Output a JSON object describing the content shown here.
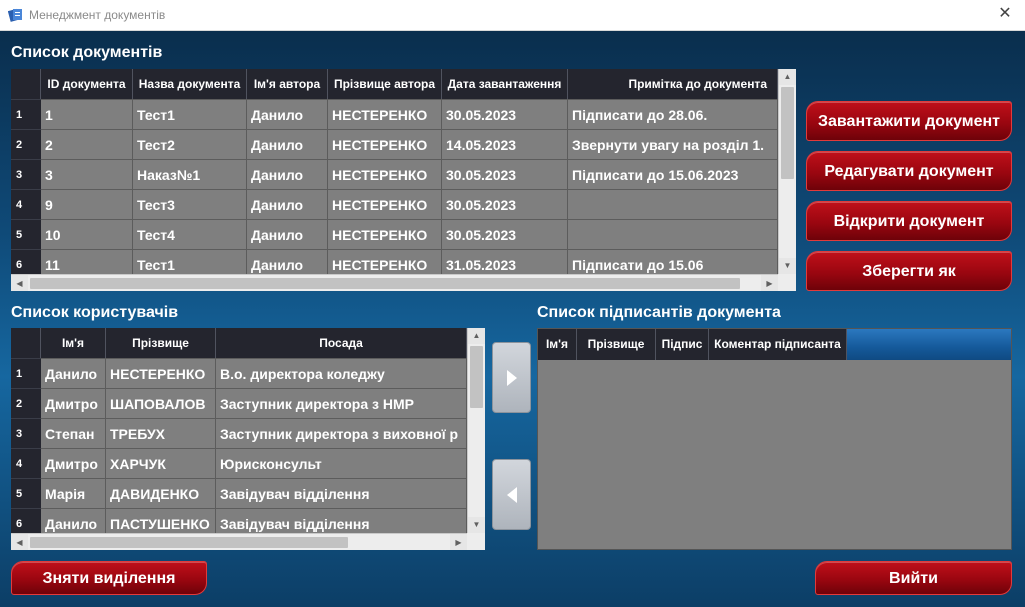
{
  "window": {
    "title": "Менеджмент документів",
    "close_glyph": "✕"
  },
  "documents": {
    "title": "Список документів",
    "columns": [
      "ID документа",
      "Назва документа",
      "Ім'я автора",
      "Прізвище автора",
      "Дата завантаження",
      "Примітка до документа"
    ],
    "rows": [
      {
        "num": "1",
        "cells": [
          "1",
          "Тест1",
          "Данило",
          "НЕСТЕРЕНКО",
          "30.05.2023",
          "Підписати до 28.06."
        ]
      },
      {
        "num": "2",
        "cells": [
          "2",
          "Тест2",
          "Данило",
          "НЕСТЕРЕНКО",
          "14.05.2023",
          "Звернути увагу на розділ 1."
        ]
      },
      {
        "num": "3",
        "cells": [
          "3",
          "Наказ№1",
          "Данило",
          "НЕСТЕРЕНКО",
          "30.05.2023",
          "Підписати до 15.06.2023"
        ]
      },
      {
        "num": "4",
        "cells": [
          "9",
          "Тест3",
          "Данило",
          "НЕСТЕРЕНКО",
          "30.05.2023",
          ""
        ]
      },
      {
        "num": "5",
        "cells": [
          "10",
          "Тест4",
          "Данило",
          "НЕСТЕРЕНКО",
          "30.05.2023",
          ""
        ]
      },
      {
        "num": "6",
        "cells": [
          "11",
          "Тест1",
          "Данило",
          "НЕСТЕРЕНКО",
          "31.05.2023",
          "Підписати до 15.06"
        ]
      }
    ]
  },
  "actions": {
    "upload": "Завантажити документ",
    "edit": "Редагувати документ",
    "open": "Відкрити документ",
    "save_as": "Зберегти як",
    "clear_selection": "Зняти виділення",
    "exit": "Вийти"
  },
  "users": {
    "title": "Список користувачів",
    "columns": [
      "Ім'я",
      "Прізвище",
      "Посада"
    ],
    "rows": [
      {
        "num": "1",
        "cells": [
          "Данило",
          "НЕСТЕРЕНКО",
          "В.о. директора коледжу"
        ]
      },
      {
        "num": "2",
        "cells": [
          "Дмитро",
          "ШАПОВАЛОВ",
          "Заступник директора з НМР"
        ]
      },
      {
        "num": "3",
        "cells": [
          "Степан",
          "ТРЕБУХ",
          "Заступник директора з виховної р"
        ]
      },
      {
        "num": "4",
        "cells": [
          "Дмитро",
          "ХАРЧУК",
          "Юрисконсульт"
        ]
      },
      {
        "num": "5",
        "cells": [
          "Марія",
          "ДАВИДЕНКО",
          "Завідувач відділення"
        ]
      },
      {
        "num": "6",
        "cells": [
          "Данило",
          "ПАСТУШЕНКО",
          "Завідувач відділення"
        ]
      }
    ]
  },
  "signers": {
    "title": "Список підписантів документа",
    "columns": [
      "Ім'я",
      "Прізвище",
      "Підпис",
      "Коментар підписанта"
    ]
  },
  "icons": {
    "app": "document-manager-icon",
    "move_right": "arrow-right-icon",
    "move_left": "arrow-left-icon"
  },
  "colors": {
    "accent_red": "#9a0610",
    "header_dark": "#24252e",
    "cell_gray": "#7f7f7f",
    "background_blue": "#0f4a78"
  }
}
